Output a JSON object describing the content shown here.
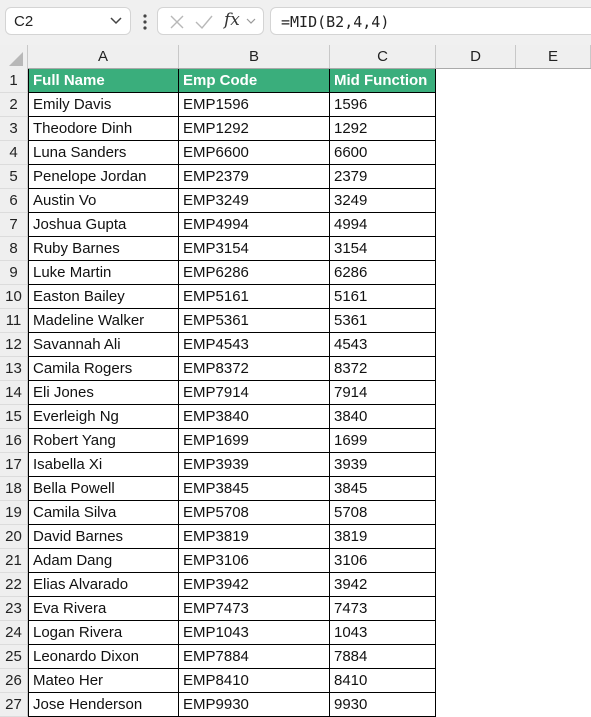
{
  "formula_bar": {
    "name_box": "C2",
    "formula": "=MID(B2,4,4)",
    "icons": [
      "cancel-icon",
      "enter-icon",
      "insert-function-icon"
    ]
  },
  "columns": [
    "A",
    "B",
    "C",
    "D",
    "E"
  ],
  "table": {
    "headers": [
      "Full Name",
      "Emp Code",
      "Mid Function"
    ],
    "header_color": "#3aae7c",
    "rows": [
      [
        "Emily Davis",
        "EMP1596",
        "1596"
      ],
      [
        "Theodore Dinh",
        "EMP1292",
        "1292"
      ],
      [
        "Luna Sanders",
        "EMP6600",
        "6600"
      ],
      [
        "Penelope Jordan",
        "EMP2379",
        "2379"
      ],
      [
        "Austin Vo",
        "EMP3249",
        "3249"
      ],
      [
        "Joshua Gupta",
        "EMP4994",
        "4994"
      ],
      [
        "Ruby Barnes",
        "EMP3154",
        "3154"
      ],
      [
        "Luke Martin",
        "EMP6286",
        "6286"
      ],
      [
        "Easton Bailey",
        "EMP5161",
        "5161"
      ],
      [
        "Madeline Walker",
        "EMP5361",
        "5361"
      ],
      [
        "Savannah Ali",
        "EMP4543",
        "4543"
      ],
      [
        "Camila Rogers",
        "EMP8372",
        "8372"
      ],
      [
        "Eli Jones",
        "EMP7914",
        "7914"
      ],
      [
        "Everleigh Ng",
        "EMP3840",
        "3840"
      ],
      [
        "Robert Yang",
        "EMP1699",
        "1699"
      ],
      [
        "Isabella Xi",
        "EMP3939",
        "3939"
      ],
      [
        "Bella Powell",
        "EMP3845",
        "3845"
      ],
      [
        "Camila Silva",
        "EMP5708",
        "5708"
      ],
      [
        "David Barnes",
        "EMP3819",
        "3819"
      ],
      [
        "Adam Dang",
        "EMP3106",
        "3106"
      ],
      [
        "Elias Alvarado",
        "EMP3942",
        "3942"
      ],
      [
        "Eva Rivera",
        "EMP7473",
        "7473"
      ],
      [
        "Logan Rivera",
        "EMP1043",
        "1043"
      ],
      [
        "Leonardo Dixon",
        "EMP7884",
        "7884"
      ],
      [
        "Mateo Her",
        "EMP8410",
        "8410"
      ],
      [
        "Jose Henderson",
        "EMP9930",
        "9930"
      ]
    ]
  }
}
